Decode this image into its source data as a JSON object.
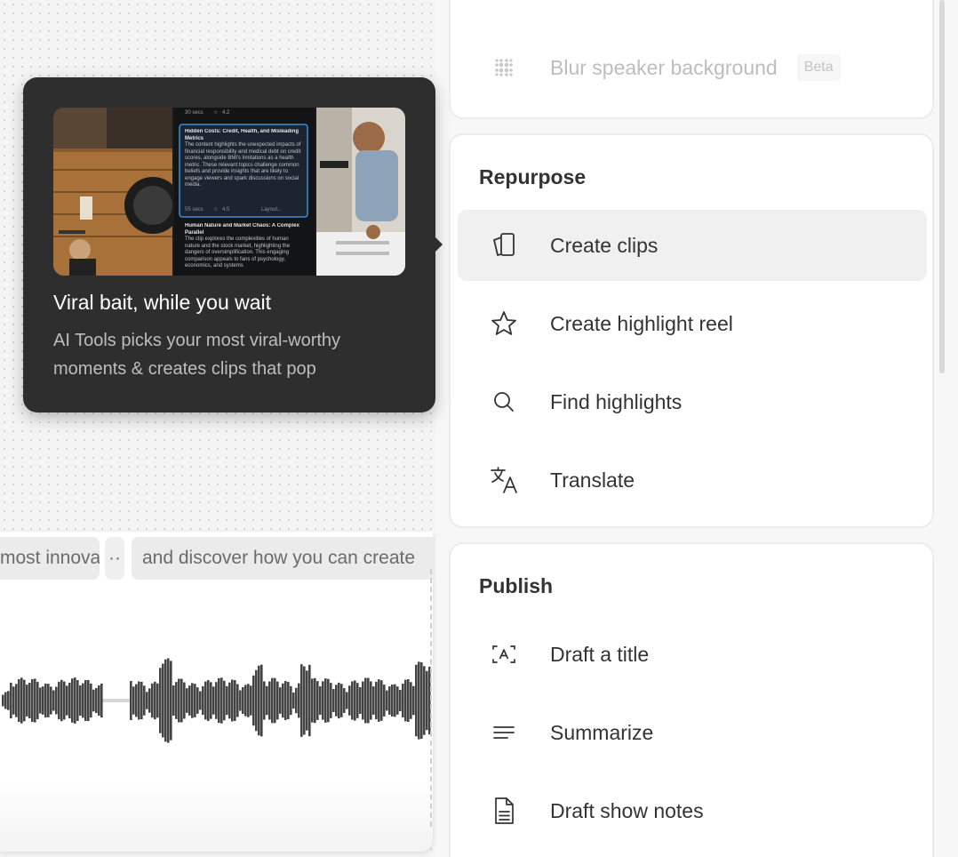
{
  "canvas": {
    "chips": [
      "most innovative",
      "··",
      "and discover how you can create"
    ]
  },
  "tooltip": {
    "title": "Viral bait, while you wait",
    "body": "AI Tools picks your most viral-worthy moments & creates clips that pop",
    "preview": {
      "card1_meta": "30 secs",
      "card1_rating": "4.2",
      "card2_title": "Hidden Costs: Credit, Health, and Misleading Metrics",
      "card2_text": "The content highlights the unexpected impacts of financial responsibility and medical debt on credit scores, alongside BMI's limitations as a health metric. These relevant topics challenge common beliefs and provide insights that are likely to engage viewers and spark discussions on social media.",
      "card2_meta": "55 secs",
      "card2_rating": "4.5",
      "card2_layout": "Layout...",
      "card3_title": "Human Nature and Market Chaos: A Complex Parallel",
      "card3_text": "The clip explores the complexities of human nature and the stock market, highlighting the dangers of oversimplification. This engaging comparison appeals to fans of psychology, economics, and systems"
    }
  },
  "top_section": {
    "items": [
      {
        "label": "Blur speaker background",
        "badge": "Beta",
        "icon": "blur-icon",
        "enabled": false
      }
    ]
  },
  "repurpose": {
    "title": "Repurpose",
    "items": [
      {
        "label": "Create clips",
        "icon": "clips-icon",
        "active": true
      },
      {
        "label": "Create highlight reel",
        "icon": "star-icon"
      },
      {
        "label": "Find highlights",
        "icon": "search-icon"
      },
      {
        "label": "Translate",
        "icon": "translate-icon"
      }
    ]
  },
  "publish": {
    "title": "Publish",
    "items": [
      {
        "label": "Draft a title",
        "icon": "title-icon"
      },
      {
        "label": "Summarize",
        "icon": "summarize-icon"
      },
      {
        "label": "Draft show notes",
        "icon": "document-icon"
      }
    ]
  },
  "colors": {
    "tooltip_bg": "#2e2e2e",
    "active_row": "#f0f0f0",
    "waveform": "#444444",
    "preview_accent": "#3a8fd6"
  }
}
